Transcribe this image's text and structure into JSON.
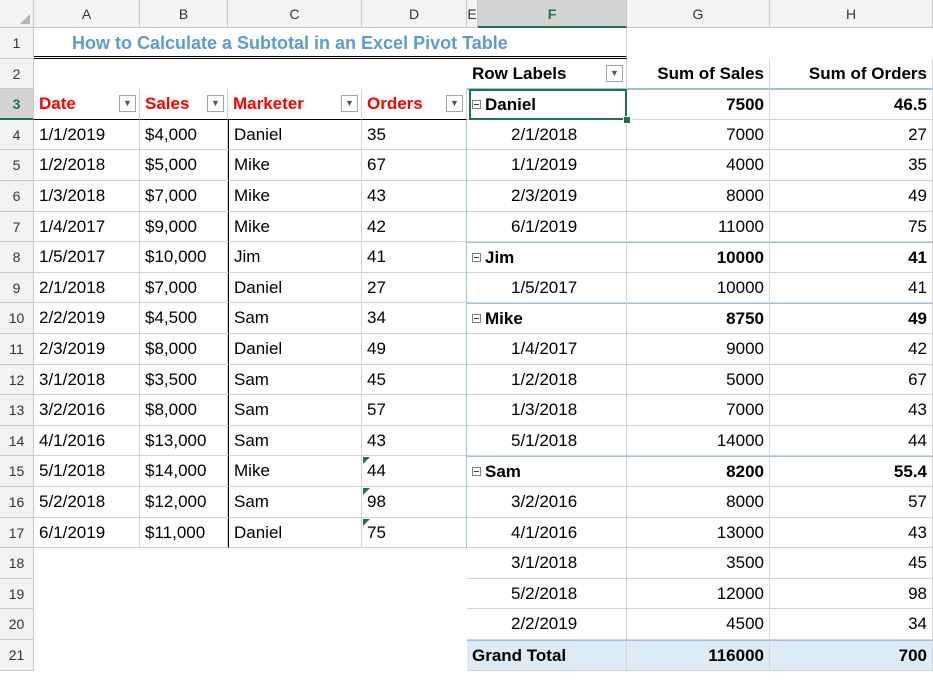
{
  "columns": [
    "A",
    "B",
    "C",
    "D",
    "E",
    "F",
    "G",
    "H"
  ],
  "rows": [
    "1",
    "2",
    "3",
    "4",
    "5",
    "6",
    "7",
    "8",
    "9",
    "10",
    "11",
    "12",
    "13",
    "14",
    "15",
    "16",
    "17",
    "18",
    "19",
    "20",
    "21"
  ],
  "title": "How to Calculate a Subtotal in an Excel Pivot Table",
  "dropdown_glyph": "▼",
  "source_table": {
    "headers": [
      "Date",
      "Sales",
      "Marketer",
      "Orders"
    ],
    "rows": [
      [
        "1/1/2019",
        "$4,000",
        "Daniel",
        "35"
      ],
      [
        "1/2/2018",
        "$5,000",
        "Mike",
        "67"
      ],
      [
        "1/3/2018",
        "$7,000",
        "Mike",
        "43"
      ],
      [
        "1/4/2017",
        "$9,000",
        "Mike",
        "42"
      ],
      [
        "1/5/2017",
        "$10,000",
        "Jim",
        "41"
      ],
      [
        "2/1/2018",
        "$7,000",
        "Daniel",
        "27"
      ],
      [
        "2/2/2019",
        "$4,500",
        "Sam",
        "34"
      ],
      [
        "2/3/2019",
        "$8,000",
        "Daniel",
        "49"
      ],
      [
        "3/1/2018",
        "$3,500",
        "Sam",
        "45"
      ],
      [
        "3/2/2016",
        "$8,000",
        "Sam",
        "57"
      ],
      [
        "4/1/2016",
        "$13,000",
        "Sam",
        "43"
      ],
      [
        "5/1/2018",
        "$14,000",
        "Mike",
        "44"
      ],
      [
        "5/2/2018",
        "$12,000",
        "Sam",
        "98"
      ],
      [
        "6/1/2019",
        "$11,000",
        "Daniel",
        "75"
      ]
    ]
  },
  "pivot": {
    "headers": [
      "Row Labels",
      "Sum of Sales",
      "Sum of Orders"
    ],
    "rows": [
      {
        "type": "group",
        "label": "Daniel",
        "sales": "7500",
        "orders": "46.5"
      },
      {
        "type": "item",
        "label": "2/1/2018",
        "sales": "7000",
        "orders": "27"
      },
      {
        "type": "item",
        "label": "1/1/2019",
        "sales": "4000",
        "orders": "35"
      },
      {
        "type": "item",
        "label": "2/3/2019",
        "sales": "8000",
        "orders": "49"
      },
      {
        "type": "item",
        "label": "6/1/2019",
        "sales": "11000",
        "orders": "75"
      },
      {
        "type": "group",
        "label": "Jim",
        "sales": "10000",
        "orders": "41"
      },
      {
        "type": "item",
        "label": "1/5/2017",
        "sales": "10000",
        "orders": "41"
      },
      {
        "type": "group",
        "label": "Mike",
        "sales": "8750",
        "orders": "49"
      },
      {
        "type": "item",
        "label": "1/4/2017",
        "sales": "9000",
        "orders": "42"
      },
      {
        "type": "item",
        "label": "1/2/2018",
        "sales": "5000",
        "orders": "67"
      },
      {
        "type": "item",
        "label": "1/3/2018",
        "sales": "7000",
        "orders": "43"
      },
      {
        "type": "item",
        "label": "5/1/2018",
        "sales": "14000",
        "orders": "44"
      },
      {
        "type": "group",
        "label": "Sam",
        "sales": "8200",
        "orders": "55.4"
      },
      {
        "type": "item",
        "label": "3/2/2016",
        "sales": "8000",
        "orders": "57"
      },
      {
        "type": "item",
        "label": "4/1/2016",
        "sales": "13000",
        "orders": "43"
      },
      {
        "type": "item",
        "label": "3/1/2018",
        "sales": "3500",
        "orders": "45"
      },
      {
        "type": "item",
        "label": "5/2/2018",
        "sales": "12000",
        "orders": "98"
      },
      {
        "type": "item",
        "label": "2/2/2019",
        "sales": "4500",
        "orders": "34"
      },
      {
        "type": "grand",
        "label": "Grand Total",
        "sales": "116000",
        "orders": "700"
      }
    ]
  },
  "selected": {
    "column": "F",
    "row": "3"
  },
  "colors": {
    "selection": "#217346",
    "title": "#5b9bd5",
    "header_red": "#ff0000",
    "pivot_band": "#ddebf7",
    "pivot_line": "#9bc2e6"
  }
}
